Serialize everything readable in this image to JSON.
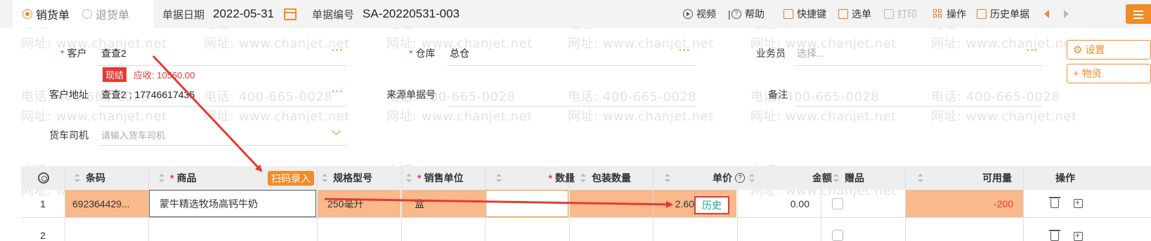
{
  "watermark": {
    "phone": "电话: 400-665-0028",
    "site": "网址: www.chanjet.net"
  },
  "doc_type": {
    "sales": "销货单",
    "returns": "退货单"
  },
  "meta": {
    "date_label": "单据日期",
    "date_value": "2022-05-31",
    "number_label": "单据编号",
    "number_value": "SA-20220531-003"
  },
  "toolbar": {
    "video": "视频",
    "help": "帮助",
    "shortcuts": "快捷键",
    "select": "选单",
    "print": "打印",
    "operation": "操作",
    "history": "历史单据"
  },
  "form": {
    "customer_label": "客户",
    "customer_value": "查查2",
    "tag_label": "现结",
    "receivable": "应收: 10560.00",
    "warehouse_label": "仓库",
    "warehouse_value": "总仓",
    "salesperson_label": "业务员",
    "salesperson_placeholder": "选择...",
    "address_label": "客户地址",
    "address_value": "查查2 ; 17746617435",
    "source_label": "来源单据号",
    "remark_label": "备注",
    "driver_label": "货车司机",
    "driver_placeholder": "请输入货车司机",
    "settings_btn": "设置",
    "add_goods_btn": "物资"
  },
  "table": {
    "headers": {
      "barcode": "条码",
      "product": "商品",
      "scan": "扫码录入",
      "spec": "规格型号",
      "unit": "销售单位",
      "qty": "数量",
      "pack_qty": "包装数量",
      "price": "单价",
      "amount": "金额",
      "gift": "赠品",
      "available": "可用量",
      "ops": "操作"
    },
    "rows": [
      {
        "no": "1",
        "barcode": "692364429...",
        "product": "蒙牛精选牧场高钙牛奶",
        "spec": "250毫升",
        "unit": "盒",
        "qty": "",
        "price": "2.60",
        "history": "历史",
        "amount": "0.00",
        "available": "-200"
      },
      {
        "no": "2"
      }
    ]
  },
  "colors": {
    "accent": "#f08c2a",
    "danger": "#e53935",
    "row_highlight": "#f9b98b",
    "link": "#14a2a2"
  }
}
